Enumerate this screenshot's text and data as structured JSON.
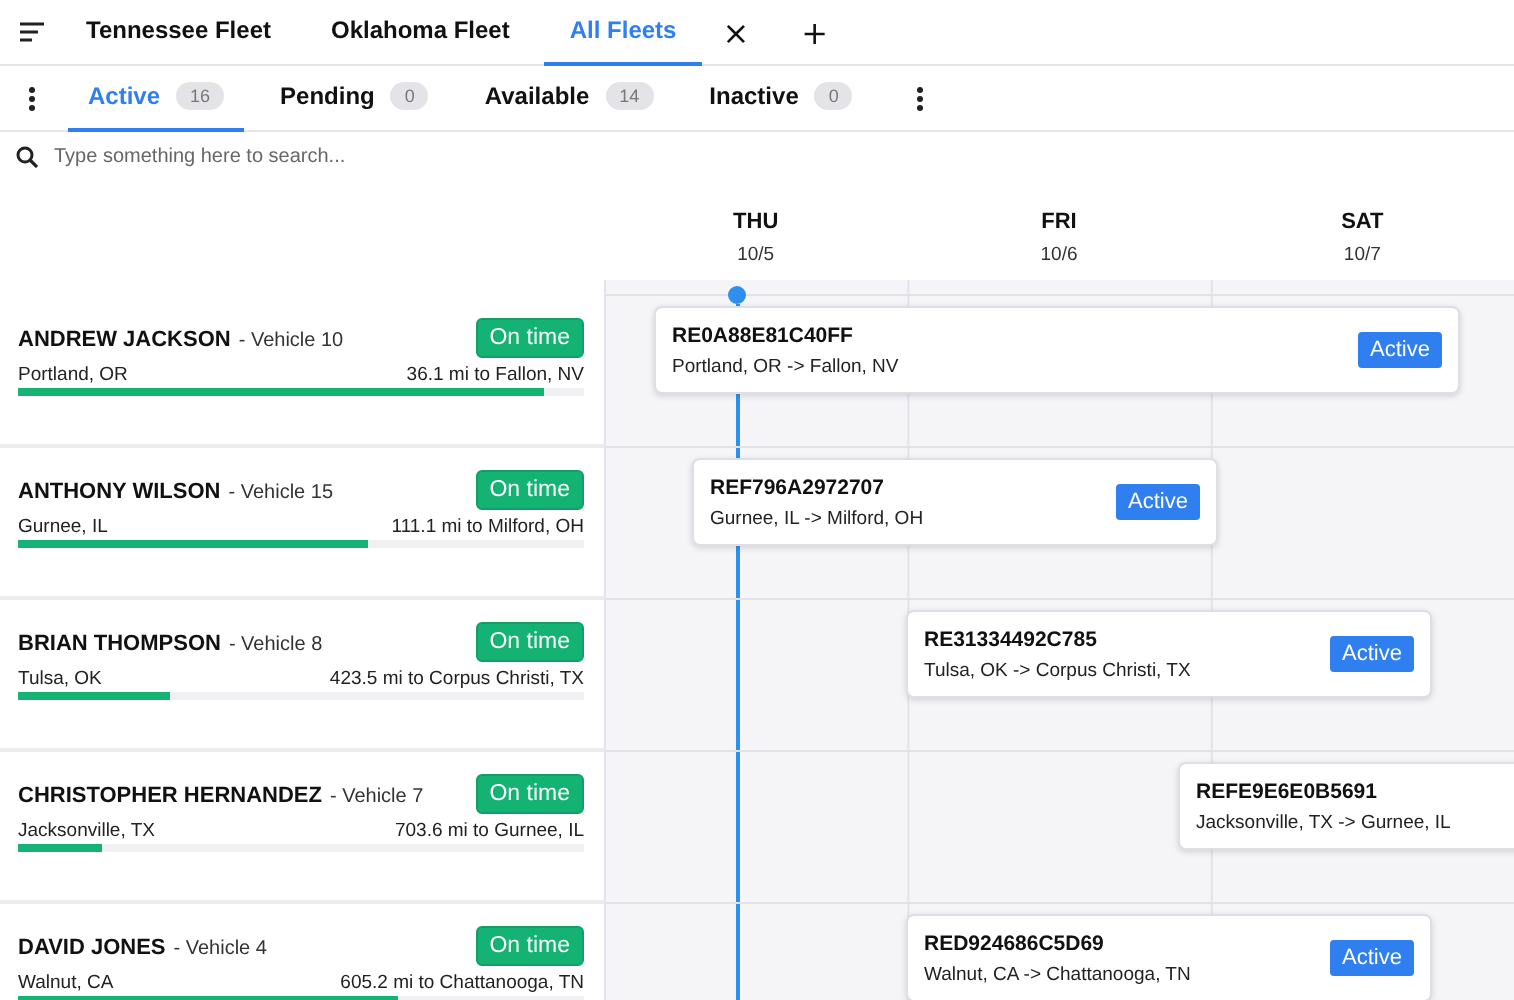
{
  "fleet_tabs": [
    {
      "label": "Tennessee Fleet",
      "selected": false
    },
    {
      "label": "Oklahoma Fleet",
      "selected": false
    },
    {
      "label": "All Fleets",
      "selected": true
    }
  ],
  "close_glyph": "×",
  "add_glyph": "+",
  "status_tabs": [
    {
      "label": "Active",
      "count": "16",
      "selected": true
    },
    {
      "label": "Pending",
      "count": "0",
      "selected": false
    },
    {
      "label": "Available",
      "count": "14",
      "selected": false
    },
    {
      "label": "Inactive",
      "count": "0",
      "selected": false
    }
  ],
  "search": {
    "placeholder": "Type something here to search..."
  },
  "days": [
    {
      "day": "THU",
      "date": "10/5"
    },
    {
      "day": "FRI",
      "date": "10/6"
    },
    {
      "day": "SAT",
      "date": "10/7"
    }
  ],
  "drivers": [
    {
      "name": "ANDREW JACKSON",
      "vehicle": "- Vehicle 10",
      "status": "On time",
      "origin": "Portland, OR",
      "distance": "36.1 mi to Fallon, NV",
      "level": 0.93,
      "trip": {
        "id": "RE0A88E81C40FF",
        "route": "Portland, OR -> Fallon, NV",
        "badge": "Active"
      }
    },
    {
      "name": "ANTHONY WILSON",
      "vehicle": "- Vehicle 15",
      "status": "On time",
      "origin": "Gurnee, IL",
      "distance": "111.1 mi to Milford, OH",
      "level": 0.62,
      "trip": {
        "id": "REF796A2972707",
        "route": "Gurnee, IL -> Milford, OH",
        "badge": "Active"
      }
    },
    {
      "name": "BRIAN THOMPSON",
      "vehicle": "- Vehicle 8",
      "status": "On time",
      "origin": "Tulsa, OK",
      "distance": "423.5 mi to Corpus Christi, TX",
      "level": 0.27,
      "trip": {
        "id": "RE31334492C785",
        "route": "Tulsa, OK -> Corpus Christi, TX",
        "badge": "Active"
      }
    },
    {
      "name": "CHRISTOPHER HERNANDEZ",
      "vehicle": "- Vehicle 7",
      "status": "On time",
      "origin": "Jacksonville, TX",
      "distance": "703.6 mi to Gurnee, IL",
      "level": 0.15,
      "trip": {
        "id": "REFE9E6E0B5691",
        "route": "Jacksonville, TX -> Gurnee, IL"
      }
    },
    {
      "name": "DAVID JONES",
      "vehicle": "- Vehicle 4",
      "status": "On time",
      "origin": "Walnut, CA",
      "distance": "605.2 mi to Chattanooga, TN",
      "level": 0.67,
      "trip": {
        "id": "RED924686C5D69",
        "route": "Walnut, CA -> Chattanooga, TN",
        "badge": "Active"
      }
    }
  ]
}
